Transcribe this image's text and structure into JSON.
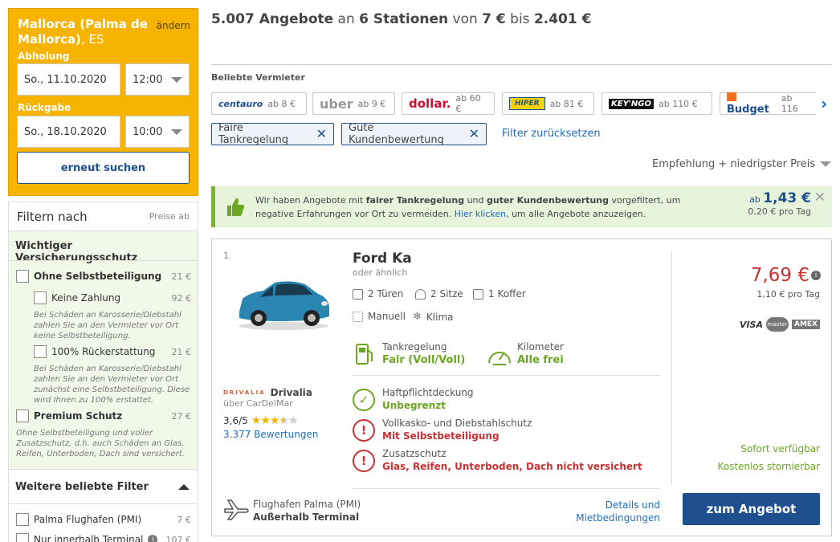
{
  "search": {
    "location": "Mallorca (Palma de Mallorca)",
    "country": ", ES",
    "change_label": "ändern",
    "pickup_label": "Abholung",
    "pickup_date": "So., 11.10.2020",
    "pickup_time": "12:00",
    "return_label": "Rückgabe",
    "return_date": "So., 18.10.2020",
    "return_time": "10:00",
    "resubmit_label": "erneut suchen"
  },
  "filters": {
    "title": "Filtern nach",
    "prices_label": "Preise ab",
    "insurance_title": "Wichtiger Versicherungsschutz",
    "insurance_items": [
      {
        "label": "Ohne Selbstbeteiligung",
        "price": "21 €"
      },
      {
        "label": "Keine Zahlung",
        "price": "92 €",
        "note": "Bei Schäden an Karosserie/Diebstahl zahlen Sie an den Vermieter vor Ort keine Selbstbeteiligung."
      },
      {
        "label": "100% Rückerstattung",
        "price": "21 €",
        "note": "Bei Schäden an Karosserie/Diebstahl zahlen Sie an den Vermieter vor Ort zunächst eine Selbstbeteiligung. Diese wird Ihnen zu 100% erstattet."
      },
      {
        "label": "Premium Schutz",
        "price": "27 €",
        "note": "Ohne Selbstbeteiligung und voller Zusatzschutz, d.h. auch Schäden an Glas, Reifen, Unterboden, Dach sind versichert."
      }
    ],
    "more_title": "Weitere beliebte Filter",
    "more_items": [
      {
        "label": "Palma Flughafen (PMI)",
        "price": "7 €"
      },
      {
        "label": "Nur innerhalb Terminal",
        "price": "107 €"
      }
    ]
  },
  "header": {
    "count": "5.007 Angebote",
    "an": " an ",
    "stations": "6 Stationen",
    "von": " von ",
    "min": "7 €",
    "bis": " bis ",
    "max": "2.401 €"
  },
  "vendors": {
    "title": "Beliebte Vermieter",
    "items": [
      {
        "name": "centauro",
        "price": "ab 8 €",
        "color": "#1e4f8f"
      },
      {
        "name": "uber",
        "price": "ab 9 €",
        "color": "#999999"
      },
      {
        "name": "dollar.",
        "price": "ab 60 €",
        "color": "#c8102e"
      },
      {
        "name": "HIPER",
        "price": "ab 81 €",
        "color": "#f0c800"
      },
      {
        "name": "KEY'NGO",
        "price": "ab 110 €",
        "color": "#111111"
      },
      {
        "name": "Budget",
        "price": "ab 116",
        "color": "#1e4f8f"
      }
    ]
  },
  "active_filters": {
    "items": [
      "Faire Tankregelung",
      "Gute Kundenbewertung"
    ],
    "reset_label": "Filter zurücksetzen"
  },
  "sort": {
    "label": "Empfehlung + niedrigster Preis"
  },
  "banner": {
    "t1": "Wir haben Angebote mit ",
    "b1": "fairer Tankregelung",
    "t2": " und ",
    "b2": "guter Kundenbewertung",
    "t3": " vorgefiltert, um negative Erfahrungen vor Ort zu vermeiden. ",
    "link": "Hier klicken",
    "t4": ", um alle Angebote anzuzeigen.",
    "price_prefix": "ab ",
    "price": "1,43 €",
    "per_day": "0,20 € pro Tag"
  },
  "offer": {
    "rank": "1.",
    "car_name": "Ford Ka",
    "similar": "oder ähnlich",
    "doors": "2 Türen",
    "seats": "2 Sitze",
    "luggage": "1 Koffer",
    "transmission": "Manuell",
    "ac": "Klima",
    "fuel_label": "Tankregelung",
    "fuel_value": "Fair (Voll/Voll)",
    "km_label": "Kilometer",
    "km_value": "Alle frei",
    "supplier_name": "Drivalia",
    "supplier_logo": "DRIVALIA",
    "supplier_via": "über CarDelMar",
    "rating": "3,6/5",
    "rating_stars": 3.6,
    "reviews": "3.377 Bewertungen",
    "liability_label": "Haftpflichtdeckung",
    "liability_value": "Unbegrenzt",
    "cdw_label": "Vollkasko- und Diebstahlschutz",
    "cdw_value": "Mit Selbstbeteiligung",
    "extra_label": "Zusatzschutz",
    "extra_value": "Glas, Reifen, Unterboden, Dach nicht versichert",
    "location_name": "Flughafen Palma (PMI)",
    "location_type": "Außerhalb Terminal",
    "details_1": "Details und",
    "details_2": "Mietbedingungen",
    "price": "7,69 €",
    "per_day": "1,10 € pro Tag",
    "payment": [
      "VISA",
      "master",
      "AMEX"
    ],
    "availability": "Sofort verfügbar",
    "cancellation": "Kostenlos stornierbar",
    "cta": "zum Angebot"
  }
}
